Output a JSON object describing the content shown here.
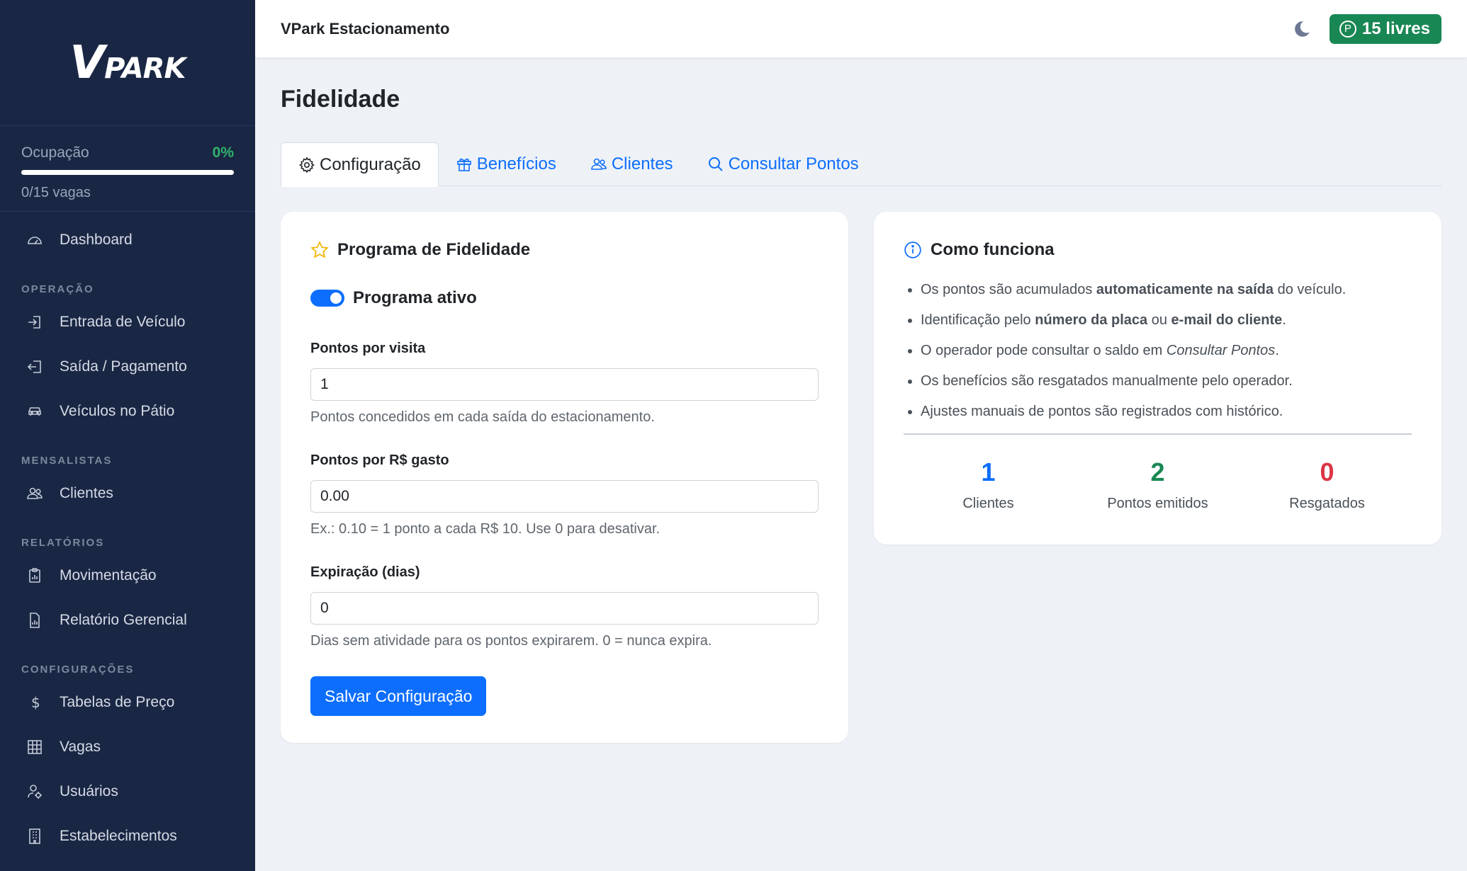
{
  "brand": {
    "logo_text_big": "V",
    "logo_text_small": "PARK"
  },
  "sidebar": {
    "occupancy_label": "Ocupação",
    "occupancy_pct": "0%",
    "occupancy_value": 0,
    "occupancy_detail": "0/15 vagas",
    "items": {
      "dashboard": "Dashboard",
      "section_operacao": "OPERAÇÃO",
      "entrada": "Entrada de Veículo",
      "saida": "Saída / Pagamento",
      "veiculos": "Veículos no Pátio",
      "section_mensalistas": "MENSALISTAS",
      "clientes": "Clientes",
      "section_relatorios": "RELATÓRIOS",
      "movimentacao": "Movimentação",
      "relatorio": "Relatório Gerencial",
      "section_config": "CONFIGURAÇÕES",
      "tabelas": "Tabelas de Preço",
      "vagas": "Vagas",
      "usuarios": "Usuários",
      "estabelecimentos": "Estabelecimentos"
    }
  },
  "topbar": {
    "title": "VPark Estacionamento",
    "free_label": "15 livres",
    "badge_icon": "P"
  },
  "page": {
    "title": "Fidelidade"
  },
  "tabs": {
    "config": "Configuração",
    "beneficios": "Benefícios",
    "clientes": "Clientes",
    "consultar": "Consultar Pontos"
  },
  "program": {
    "title": "Programa de Fidelidade",
    "active_label": "Programa ativo",
    "active": true,
    "points_visit_label": "Pontos por visita",
    "points_visit_value": "1",
    "points_visit_help": "Pontos concedidos em cada saída do estacionamento.",
    "points_spent_label": "Pontos por R$ gasto",
    "points_spent_value": "0.00",
    "points_spent_help": "Ex.: 0.10 = 1 ponto a cada R$ 10. Use 0 para desativar.",
    "expiry_label": "Expiração (dias)",
    "expiry_value": "0",
    "expiry_help": "Dias sem atividade para os pontos expirarem. 0 = nunca expira.",
    "save_label": "Salvar Configuração"
  },
  "how": {
    "title": "Como funciona",
    "items": [
      {
        "a": "Os pontos são acumulados ",
        "b": "automaticamente na saída",
        "c": " do veículo."
      },
      {
        "a": "Identificação pelo ",
        "b": "número da placa",
        "c": " ou ",
        "d": "e-mail do cliente",
        "e": "."
      },
      {
        "a": "O operador pode consultar o saldo em ",
        "i": "Consultar Pontos",
        "c": "."
      },
      {
        "a": "Os benefícios são resgatados manualmente pelo operador."
      },
      {
        "a": "Ajustes manuais de pontos são registrados com histórico."
      }
    ],
    "stats": [
      {
        "value": "1",
        "label": "Clientes",
        "color": "#0d6efd"
      },
      {
        "value": "2",
        "label": "Pontos emitidos",
        "color": "#198754"
      },
      {
        "value": "0",
        "label": "Resgatados",
        "color": "#dc3545"
      }
    ]
  },
  "colors": {
    "sidebar": "#1a2744",
    "accent": "#0d6efd",
    "success": "#198754",
    "danger": "#dc3545"
  }
}
